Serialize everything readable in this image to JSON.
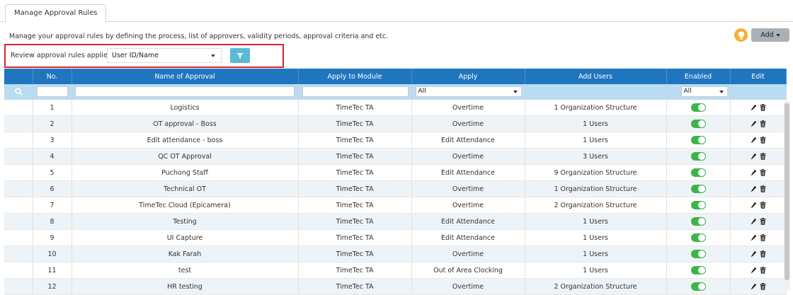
{
  "tab": {
    "label": "Manage Approval Rules"
  },
  "description": "Manage your approval rules by defining the process, list of approvers, validity periods, approval criteria and etc.",
  "add_button": {
    "label": "Add"
  },
  "review": {
    "label": "Review approval rules applied to",
    "selected": "User ID/Name"
  },
  "table": {
    "headers": [
      "",
      "No.",
      "Name of Approval",
      "Apply to Module",
      "Apply",
      "Add Users",
      "Enabled",
      "Edit"
    ],
    "filters": {
      "apply": "All",
      "enabled": "All"
    },
    "rows": [
      {
        "no": "1",
        "name": "Logistics",
        "module": "TimeTec TA",
        "apply": "Overtime",
        "users": "1 Organization Structure"
      },
      {
        "no": "2",
        "name": "OT approval - Boss",
        "module": "TimeTec TA",
        "apply": "Overtime",
        "users": "1 Users"
      },
      {
        "no": "3",
        "name": "Edit attendance - boss",
        "module": "TimeTec TA",
        "apply": "Edit Attendance",
        "users": "1 Users"
      },
      {
        "no": "4",
        "name": "QC OT Approval",
        "module": "TimeTec TA",
        "apply": "Overtime",
        "users": "3 Users"
      },
      {
        "no": "5",
        "name": "Puchong Staff",
        "module": "TimeTec TA",
        "apply": "Edit Attendance",
        "users": "9 Organization Structure"
      },
      {
        "no": "6",
        "name": "Technical OT",
        "module": "TimeTec TA",
        "apply": "Overtime",
        "users": "1 Organization Structure"
      },
      {
        "no": "7",
        "name": "TimeTec Cloud (Epicamera)",
        "module": "TimeTec TA",
        "apply": "Overtime",
        "users": "2 Organization Structure"
      },
      {
        "no": "8",
        "name": "Testing",
        "module": "TimeTec TA",
        "apply": "Edit Attendance",
        "users": "1 Users"
      },
      {
        "no": "9",
        "name": "UI Capture",
        "module": "TimeTec TA",
        "apply": "Edit Attendance",
        "users": "1 Users"
      },
      {
        "no": "10",
        "name": "Kak Farah",
        "module": "TimeTec TA",
        "apply": "Overtime",
        "users": "1 Users"
      },
      {
        "no": "11",
        "name": "test",
        "module": "TimeTec TA",
        "apply": "Out of Area Clocking",
        "users": "1 Users"
      },
      {
        "no": "12",
        "name": "HR testing",
        "module": "TimeTec TA",
        "apply": "Overtime",
        "users": "2 Organization Structure"
      }
    ]
  },
  "colors": {
    "header": "#1f76bf",
    "filter_row": "#b9dcf1",
    "toggle_on": "#3bb54a",
    "highlight_border": "#d9262b",
    "filter_button": "#5bbad5",
    "bulb": "#f5b02f"
  }
}
